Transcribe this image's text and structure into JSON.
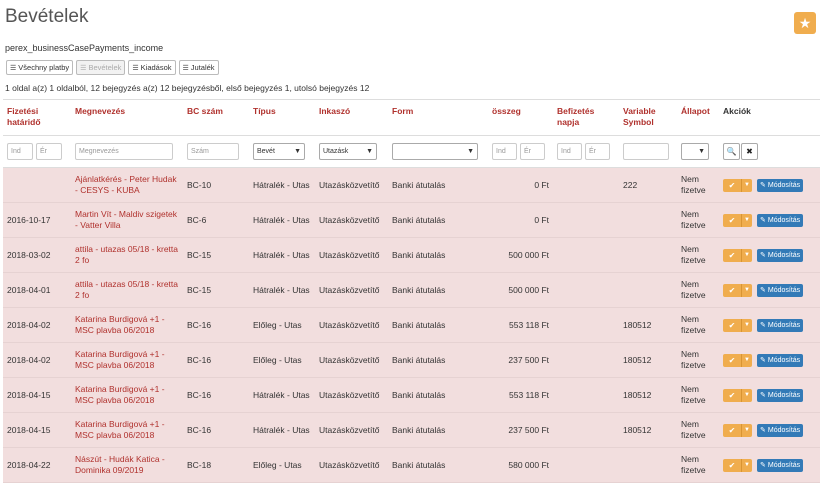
{
  "page": {
    "title": "Bevételek",
    "subtitle": "perex_businessCasePayments_income",
    "pager_info": "1 oldal a(z) 1 oldalból, 12 bejegyzés a(z) 12 bejegyzésből, első bejegyzés 1, utolsó bejegyzés 12",
    "star_icon": "★"
  },
  "filter_buttons": {
    "all": "Všechny platby",
    "income": "Bevételek",
    "expenses": "Kiadások",
    "rewards": "Jutalék"
  },
  "columns": {
    "due": "Fizetési határidő",
    "name": "Megnevezés",
    "bc": "BC szám",
    "type": "Típus",
    "collector": "Inkaszó",
    "form": "Form",
    "amount": "összeg",
    "paid": "Befizetés napja",
    "vs": "Variable Symbol",
    "status": "Állapot",
    "actions": "Akciók"
  },
  "filters": {
    "due_from": "Ind",
    "due_to": "Ér",
    "name": "Megnevezés",
    "bc": "Szám",
    "type": "Bevét",
    "collector": "Utazásk",
    "form": "",
    "amount_from": "Ind",
    "amount_to": "Ér",
    "paid_from": "Ind",
    "paid_to": "Ér",
    "vs": "",
    "status": ""
  },
  "row_actions": {
    "edit_label": "Módosítás"
  },
  "rows": [
    {
      "due": "",
      "name": "Ajánlatkérés - Peter Hudak - CESYS - KUBA",
      "bc": "BC-10",
      "type": "Hátralék - Utas",
      "collector": "Utazásközvetítő",
      "form": "Banki átutalás",
      "amount": "0 Ft",
      "paid": "",
      "vs": "222",
      "status": "Nem fizetve"
    },
    {
      "due": "2016-10-17",
      "name": "Martin Vít - Maldiv szigetek - Vatter Villa",
      "bc": "BC-6",
      "type": "Hátralék - Utas",
      "collector": "Utazásközvetítő",
      "form": "Banki átutalás",
      "amount": "0 Ft",
      "paid": "",
      "vs": "",
      "status": "Nem fizetve"
    },
    {
      "due": "2018-03-02",
      "name": "attila - utazas 05/18 - kretta 2 fo",
      "bc": "BC-15",
      "type": "Hátralék - Utas",
      "collector": "Utazásközvetítő",
      "form": "Banki átutalás",
      "amount": "500 000 Ft",
      "paid": "",
      "vs": "",
      "status": "Nem fizetve"
    },
    {
      "due": "2018-04-01",
      "name": "attila - utazas 05/18 - kretta 2 fo",
      "bc": "BC-15",
      "type": "Hátralék - Utas",
      "collector": "Utazásközvetítő",
      "form": "Banki átutalás",
      "amount": "500 000 Ft",
      "paid": "",
      "vs": "",
      "status": "Nem fizetve"
    },
    {
      "due": "2018-04-02",
      "name": "Katarina Burdigová +1 - MSC plavba 06/2018",
      "bc": "BC-16",
      "type": "Előleg - Utas",
      "collector": "Utazásközvetítő",
      "form": "Banki átutalás",
      "amount": "553 118 Ft",
      "paid": "",
      "vs": "180512",
      "status": "Nem fizetve"
    },
    {
      "due": "2018-04-02",
      "name": "Katarina Burdigová +1 - MSC plavba 06/2018",
      "bc": "BC-16",
      "type": "Előleg - Utas",
      "collector": "Utazásközvetítő",
      "form": "Banki átutalás",
      "amount": "237 500 Ft",
      "paid": "",
      "vs": "180512",
      "status": "Nem fizetve"
    },
    {
      "due": "2018-04-15",
      "name": "Katarina Burdigová +1 - MSC plavba 06/2018",
      "bc": "BC-16",
      "type": "Hátralék - Utas",
      "collector": "Utazásközvetítő",
      "form": "Banki átutalás",
      "amount": "553 118 Ft",
      "paid": "",
      "vs": "180512",
      "status": "Nem fizetve"
    },
    {
      "due": "2018-04-15",
      "name": "Katarina Burdigová +1 - MSC plavba 06/2018",
      "bc": "BC-16",
      "type": "Hátralék - Utas",
      "collector": "Utazásközvetítő",
      "form": "Banki átutalás",
      "amount": "237 500 Ft",
      "paid": "",
      "vs": "180512",
      "status": "Nem fizetve"
    },
    {
      "due": "2018-04-22",
      "name": "Nászút - Hudák Katica - Dominika 09/2019",
      "bc": "BC-18",
      "type": "Előleg - Utas",
      "collector": "Utazásközvetítő",
      "form": "Banki átutalás",
      "amount": "580 000 Ft",
      "paid": "",
      "vs": "",
      "status": "Nem fizetve"
    }
  ]
}
